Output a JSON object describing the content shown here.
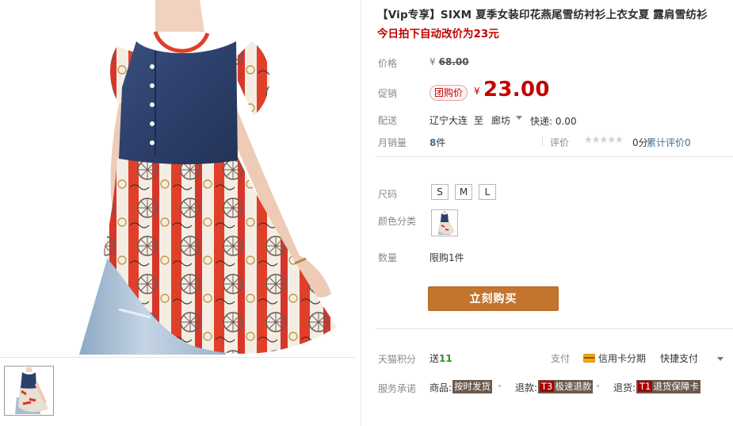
{
  "product": {
    "title": "【Vip专享】SIXM 夏季女装印花燕尾雪纺衬衫上衣女夏 露肩雪纺衫",
    "subtitle": "今日拍下自动改价为23元"
  },
  "price": {
    "label": "价格",
    "currency": "¥",
    "original": "68.00"
  },
  "promotion": {
    "label": "促销",
    "tag": "团购价",
    "currency": "¥",
    "price": "23.00"
  },
  "delivery": {
    "label": "配送",
    "from": "辽宁大连",
    "to": "至",
    "city": "廊坊",
    "fee": "快递: 0.00"
  },
  "sales": {
    "label": "月销量",
    "count": "8",
    "unit": "件",
    "review_label": "评价",
    "stars": "★★★★★",
    "score": "0分",
    "review_count_label": "累计评价0"
  },
  "size": {
    "label": "尺码",
    "options": [
      "S",
      "M",
      "L"
    ]
  },
  "color": {
    "label": "颜色分类"
  },
  "quantity": {
    "label": "数量",
    "limit": "限购1件"
  },
  "buy_button": "立刻购买",
  "points": {
    "label": "天猫积分",
    "prefix": "送",
    "value": "11"
  },
  "payment": {
    "label": "支付",
    "installment": "信用卡分期",
    "quick_pay": "快捷支付"
  },
  "service": {
    "label": "服务承诺",
    "items": [
      {
        "key": "商品:",
        "code": "",
        "text": "按时发货"
      },
      {
        "key": "退款:",
        "code": "T3",
        "text": "极速退款"
      },
      {
        "key": "退货:",
        "code": "T1",
        "text": "退货保障卡"
      }
    ]
  },
  "colors": {
    "price_red": "#c40000",
    "buy_button": "#c3742d",
    "link_blue": "#3c6e9a",
    "badge_bg": "#6b5a4e"
  },
  "icons": {
    "card": "credit-card-icon",
    "caret": "chevron-down-icon",
    "stars": "star-rating-icon"
  }
}
